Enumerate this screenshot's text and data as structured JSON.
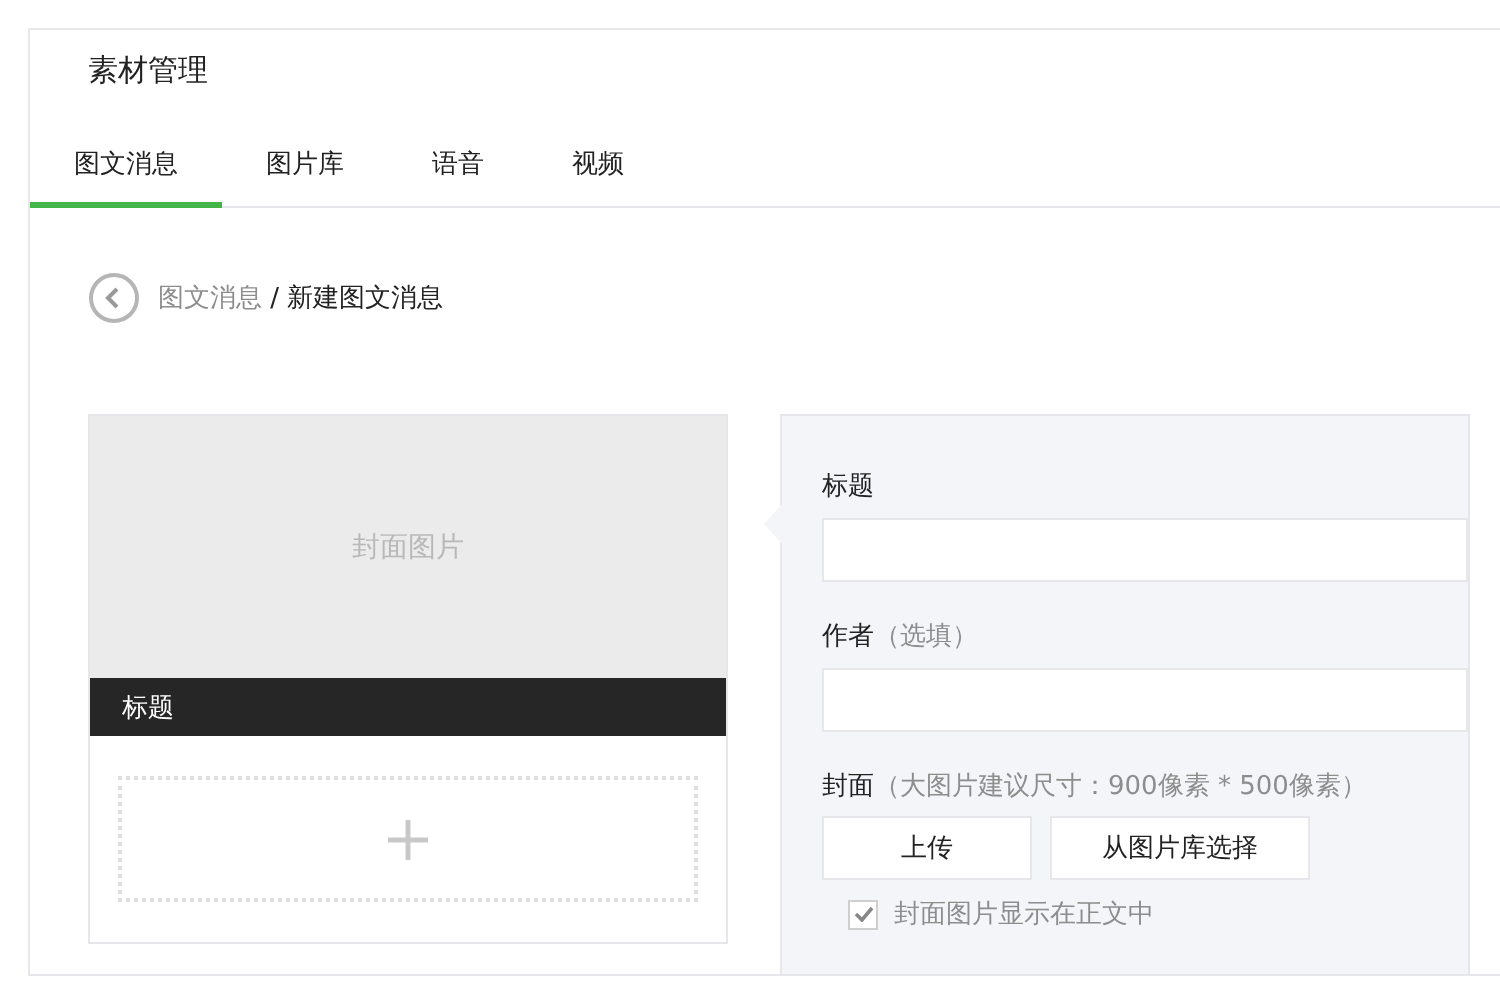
{
  "header": {
    "title": "素材管理"
  },
  "tabs": [
    {
      "label": "图文消息",
      "selected": true
    },
    {
      "label": "图片库",
      "selected": false
    },
    {
      "label": "语音",
      "selected": false
    },
    {
      "label": "视频",
      "selected": false
    }
  ],
  "breadcrumb": {
    "parent": "图文消息",
    "separator": "/",
    "current": "新建图文消息"
  },
  "preview": {
    "cover_text": "封面图片",
    "title": "标题"
  },
  "form": {
    "fields": [
      {
        "label": "标题"
      },
      {
        "label": "作者",
        "hint": "（选填）"
      }
    ],
    "cover": {
      "label": "封面",
      "hint": "（大图片建议尺寸：900像素 * 500像素）",
      "buttons": [
        "上传",
        "从图片库选择"
      ],
      "show_in_body": {
        "label": "封面图片显示在正文中",
        "checked": true
      }
    }
  }
}
